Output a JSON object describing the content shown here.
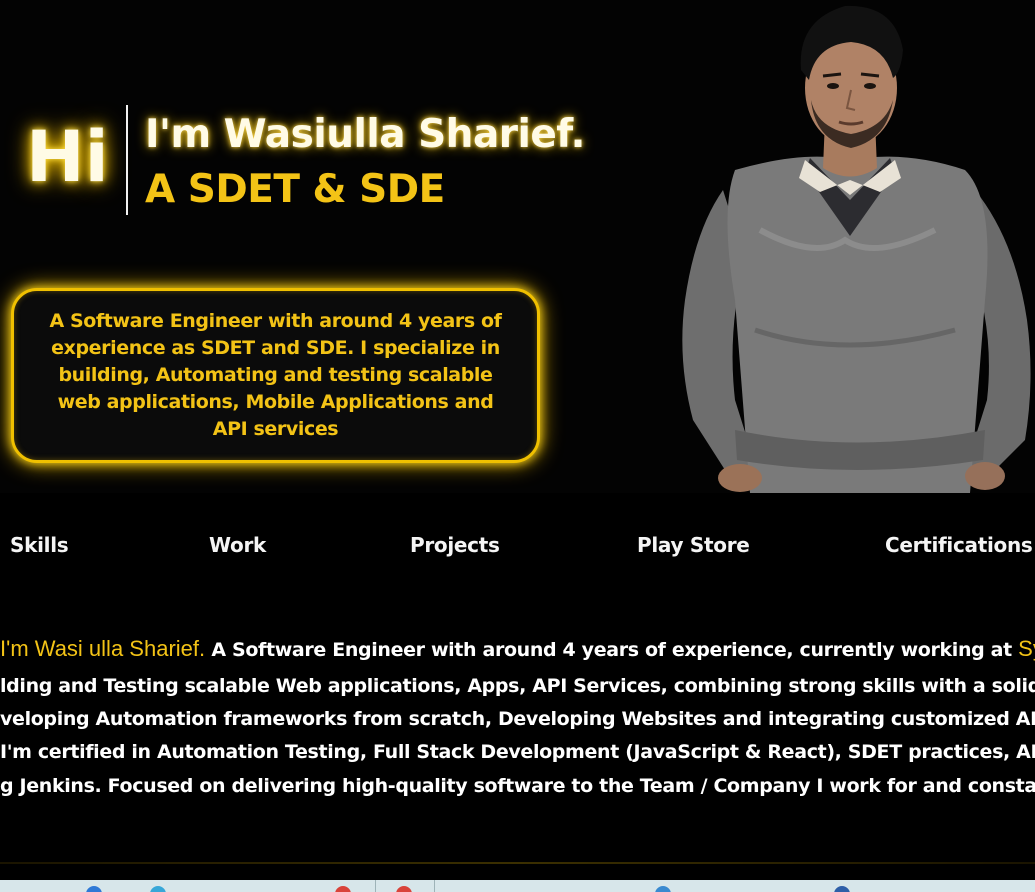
{
  "hero": {
    "greeting": "Hi",
    "name_line": "I'm Wasiulla Sharief.",
    "role_line": "A SDET & SDE",
    "intro": "A Software Engineer with around 4 years of experience as SDET and SDE. I specialize in building, Automating and testing scalable web applications, Mobile Applications and API services"
  },
  "nav": {
    "items": [
      "Skills",
      "Work",
      "Projects",
      "Play Store",
      "Certifications"
    ]
  },
  "about": {
    "line1_name": "I'm Wasi ulla Sharief.",
    "line1_text": " A Software Engineer with around 4 years of experience, currently working at ",
    "line1_company": "Synech",
    "line2": "lding and Testing scalable Web applications, Apps, API Services, combining strong skills with a solid foundation",
    "line3": "veloping Automation frameworks from scratch, Developing Websites and integrating customized AI chatbots i",
    "line4": " I'm certified in Automation Testing, Full Stack Development (JavaScript & React), SDET practices, AI Prompt En",
    "line5": "g Jenkins. Focused on delivering high-quality software to the Team / Company I work for and constantly explor"
  },
  "colors": {
    "accent": "#f3c316",
    "background": "#000000",
    "text": "#ffffff"
  }
}
